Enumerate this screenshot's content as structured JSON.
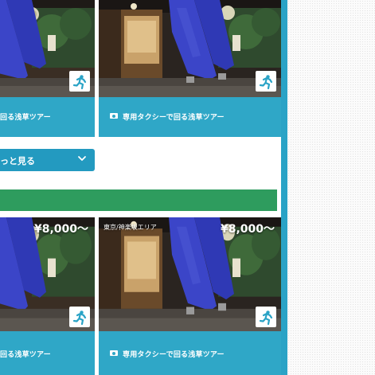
{
  "colors": {
    "accent": "#2fa7c7",
    "button": "#239ac0",
    "section_bar": "#2e9c5e",
    "side_divider": "#2aa3c6"
  },
  "top_row": {
    "left_card": {
      "title": "回る浅草ツアー",
      "camera_icon": "camera-icon",
      "badge_icon": "running-man-icon"
    },
    "right_card": {
      "title": "専用タクシーで回る浅草ツアー",
      "camera_icon": "camera-icon",
      "badge_icon": "running-man-icon"
    }
  },
  "more_button": {
    "label": "っと見る",
    "icon": "chevron-down-icon"
  },
  "bottom_row": {
    "left_card": {
      "price": "¥8,000〜",
      "title": "回る浅草ツアー",
      "badge_icon": "running-man-icon"
    },
    "right_card": {
      "area": "東京/神楽坂エリア",
      "price": "¥8,000〜",
      "title": "専用タクシーで回る浅草ツアー",
      "camera_icon": "camera-icon",
      "badge_icon": "running-man-icon"
    }
  }
}
